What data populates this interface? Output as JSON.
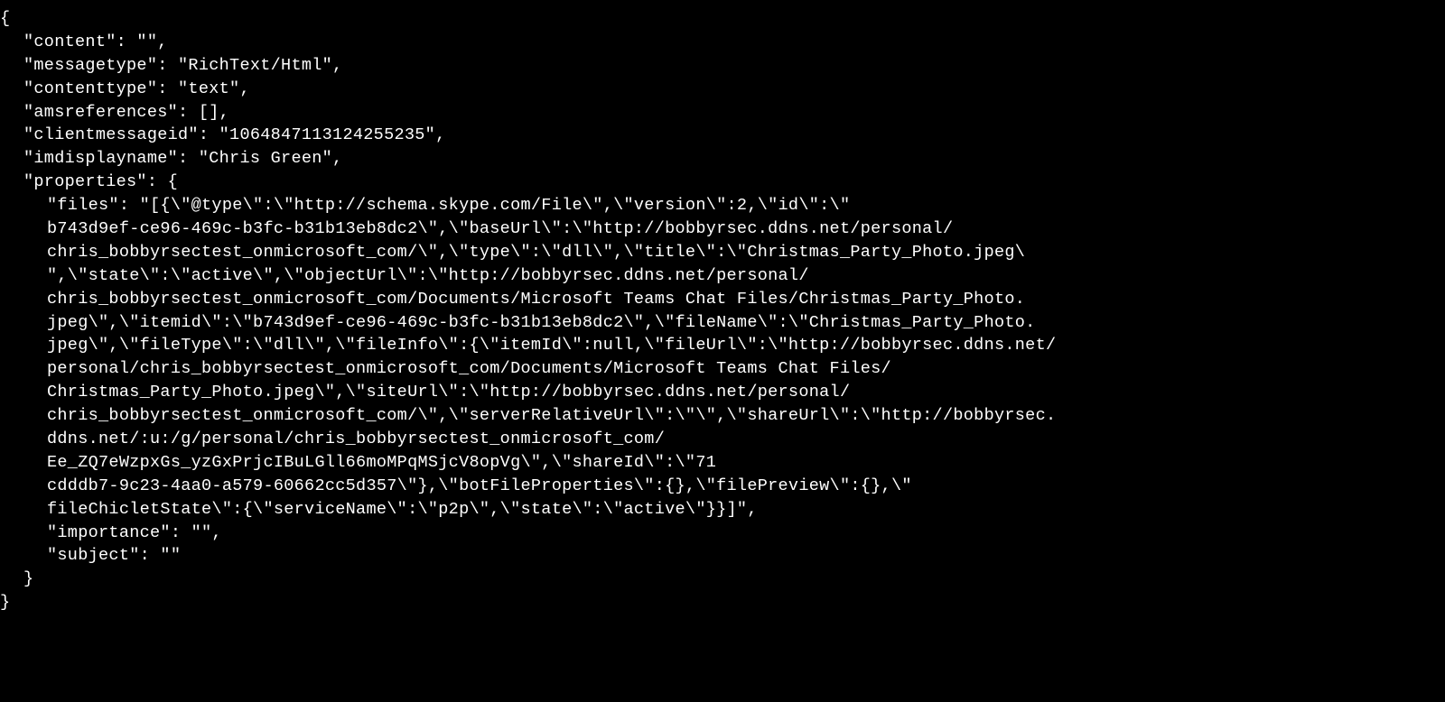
{
  "json_display": {
    "line1": "{",
    "line2": "\"content\": \"\",",
    "line3": "\"messagetype\": \"RichText/Html\",",
    "line4": "\"contenttype\": \"text\",",
    "line5": "\"amsreferences\": [],",
    "line6": "\"clientmessageid\": \"1064847113124255235\",",
    "line7": "\"imdisplayname\": \"Chris Green\",",
    "line8": "\"properties\": {",
    "line9": "\"files\": \"[{\\\"@type\\\":\\\"http://schema.skype.com/File\\\",\\\"version\\\":2,\\\"id\\\":\\\"",
    "line10": "b743d9ef-ce96-469c-b3fc-b31b13eb8dc2\\\",\\\"baseUrl\\\":\\\"http://bobbyrsec.ddns.net/personal/",
    "line11": "chris_bobbyrsectest_onmicrosoft_com/\\\",\\\"type\\\":\\\"dll\\\",\\\"title\\\":\\\"Christmas_Party_Photo.jpeg\\",
    "line12": "\",\\\"state\\\":\\\"active\\\",\\\"objectUrl\\\":\\\"http://bobbyrsec.ddns.net/personal/",
    "line13": "chris_bobbyrsectest_onmicrosoft_com/Documents/Microsoft Teams Chat Files/Christmas_Party_Photo.",
    "line14": "jpeg\\\",\\\"itemid\\\":\\\"b743d9ef-ce96-469c-b3fc-b31b13eb8dc2\\\",\\\"fileName\\\":\\\"Christmas_Party_Photo.",
    "line15": "jpeg\\\",\\\"fileType\\\":\\\"dll\\\",\\\"fileInfo\\\":{\\\"itemId\\\":null,\\\"fileUrl\\\":\\\"http://bobbyrsec.ddns.net/",
    "line16": "personal/chris_bobbyrsectest_onmicrosoft_com/Documents/Microsoft Teams Chat Files/",
    "line17": "Christmas_Party_Photo.jpeg\\\",\\\"siteUrl\\\":\\\"http://bobbyrsec.ddns.net/personal/",
    "line18": "chris_bobbyrsectest_onmicrosoft_com/\\\",\\\"serverRelativeUrl\\\":\\\"\\\",\\\"shareUrl\\\":\\\"http://bobbyrsec.",
    "line19": "ddns.net/:u:/g/personal/chris_bobbyrsectest_onmicrosoft_com/",
    "line20": "Ee_ZQ7eWzpxGs_yzGxPrjcIBuLGll66moMPqMSjcV8opVg\\\",\\\"shareId\\\":\\\"71",
    "line21": "cdddb7-9c23-4aa0-a579-60662cc5d357\\\"},\\\"botFileProperties\\\":{},\\\"filePreview\\\":{},\\\"",
    "line22": "fileChicletState\\\":{\\\"serviceName\\\":\\\"p2p\\\",\\\"state\\\":\\\"active\\\"}}]\",",
    "line23": "\"importance\": \"\",",
    "line24": "\"subject\": \"\"",
    "line25": "}",
    "line26": "}"
  }
}
